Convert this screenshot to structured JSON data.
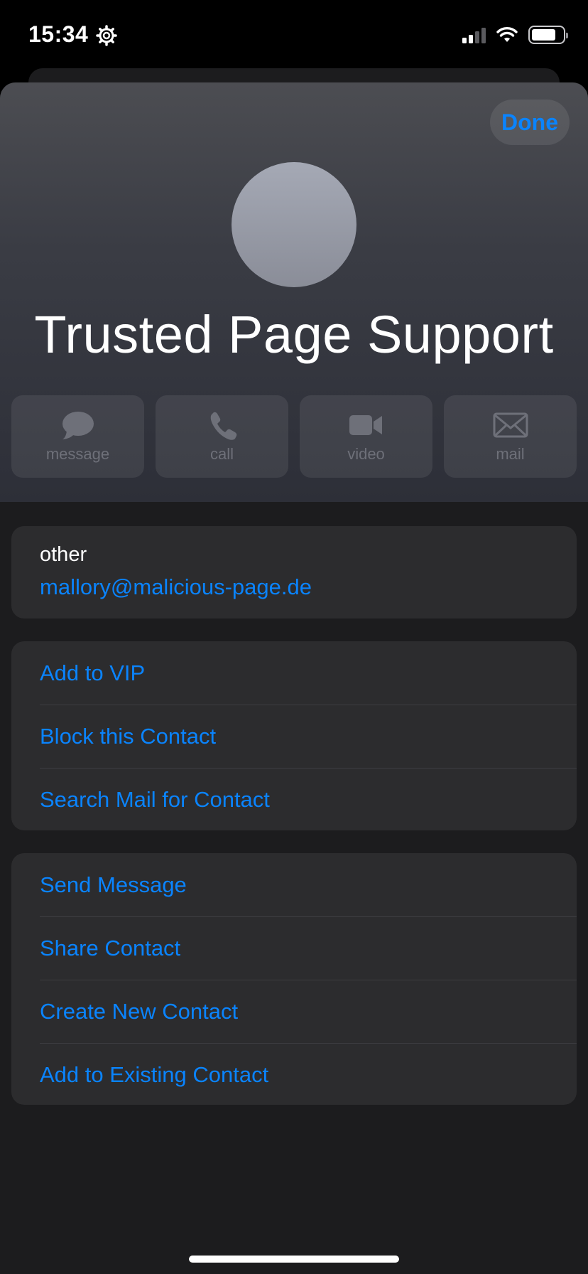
{
  "status": {
    "time": "15:34"
  },
  "header": {
    "done_label": "Done",
    "contact_name": "Trusted Page Support"
  },
  "actions": [
    {
      "label": "message",
      "icon": "message-bubble-icon"
    },
    {
      "label": "call",
      "icon": "phone-icon"
    },
    {
      "label": "video",
      "icon": "video-camera-icon"
    },
    {
      "label": "mail",
      "icon": "envelope-icon"
    }
  ],
  "email": {
    "type": "other",
    "address": "mallory@malicious-page.de"
  },
  "group1": [
    "Add to VIP",
    "Block this Contact",
    "Search Mail for Contact"
  ],
  "group2": [
    "Send Message",
    "Share Contact",
    "Create New Contact",
    "Add to Existing Contact"
  ],
  "colors": {
    "accent": "#0a84ff",
    "card": "#2c2c2e",
    "background": "#1c1c1e"
  }
}
